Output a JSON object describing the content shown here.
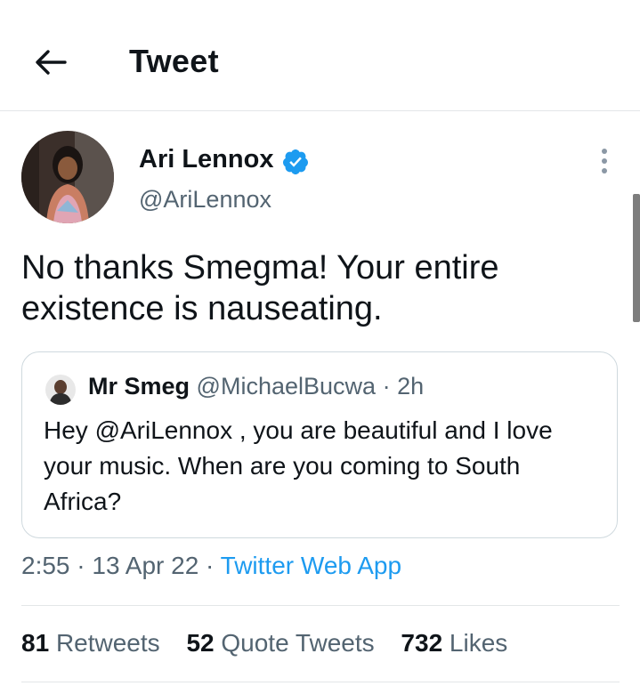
{
  "header": {
    "title": "Tweet",
    "back_icon": "arrow-left-icon"
  },
  "author": {
    "name": "Ari Lennox",
    "handle": "@AriLennox",
    "verified": true,
    "verified_color": "#1d9bf0"
  },
  "tweet": {
    "text": "No thanks Smegma! Your entire existence is nauseating."
  },
  "quoted": {
    "name": "Mr Smeg",
    "handle": "@MichaelBucwa",
    "separator": "·",
    "time": "2h",
    "text": "Hey @AriLennox , you are beautiful and I love your music. When are you coming to South Africa?"
  },
  "meta": {
    "time": "2:55",
    "dot1": "·",
    "date": "13 Apr 22",
    "dot2": "·",
    "source": "Twitter Web App",
    "source_color": "#1d9bf0"
  },
  "stats": {
    "retweets_count": "81",
    "retweets_label": "Retweets",
    "quotes_count": "52",
    "quotes_label": "Quote Tweets",
    "likes_count": "732",
    "likes_label": "Likes"
  }
}
